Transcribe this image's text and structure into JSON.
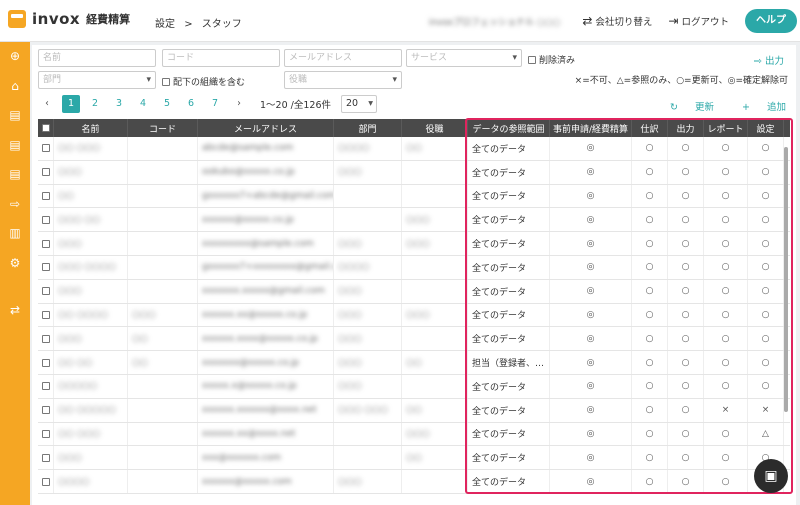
{
  "app": {
    "logo": "invox",
    "logo_sub": "経費精算"
  },
  "breadcrumb": {
    "level1": "設定",
    "separator": ">",
    "level2": "スタッフ"
  },
  "header": {
    "company": "invoxプロフェッショナル",
    "user": "○○○",
    "switch_company": "会社切り替え",
    "logout": "ログアウト",
    "help": "ヘルプ"
  },
  "sidebar_icons": [
    "plus-circle-icon",
    "home-icon",
    "document-icon",
    "document-icon",
    "document-icon",
    "export-icon",
    "chart-icon",
    "gear-icon",
    "transfer-icon"
  ],
  "filters": {
    "name_placeholder": "名前",
    "code_placeholder": "コード",
    "email_placeholder": "メールアドレス",
    "service_placeholder": "サービス",
    "deleted_label": "削除済み",
    "dept_placeholder": "部門",
    "include_sub_label": "配下の組織を含む",
    "position_placeholder": "役職",
    "output_label": "出力",
    "legend": "×=不可、△=参照のみ、○=更新可、◎=確定解除可"
  },
  "pager": {
    "pages": [
      "1",
      "2",
      "3",
      "4",
      "5",
      "6",
      "7"
    ],
    "prev": "‹",
    "next": "›",
    "info": "1〜20 /全126件",
    "per_page": "20",
    "refresh": "更新",
    "add": "追加"
  },
  "table": {
    "headers": [
      "名前",
      "コード",
      "メールアドレス",
      "部門",
      "役職",
      "データの参照範囲",
      "事前申請/経費精算",
      "仕訳",
      "出力",
      "レポート",
      "設定"
    ],
    "rows": [
      {
        "name": "○○ ○○○",
        "code": "",
        "email": "abcde@sample.com",
        "dept": "○○○○",
        "pos": "○○",
        "scope": "全てのデータ",
        "pre": "◎",
        "j": "○",
        "o": "○",
        "r": "○",
        "s": "○"
      },
      {
        "name": "○○○",
        "code": "",
        "email": "ookubo@xxxxx.co.jp",
        "dept": "○○○",
        "pos": "",
        "scope": "全てのデータ",
        "pre": "◎",
        "j": "○",
        "o": "○",
        "r": "○",
        "s": "○"
      },
      {
        "name": "○○",
        "code": "",
        "email": "gxxxxxx7+abcde@gmail.com",
        "dept": "",
        "pos": "",
        "scope": "全てのデータ",
        "pre": "◎",
        "j": "○",
        "o": "○",
        "r": "○",
        "s": "○"
      },
      {
        "name": "○○○ ○○",
        "code": "",
        "email": "xxxxxx@xxxxx.co.jp",
        "dept": "",
        "pos": "○○○",
        "scope": "全てのデータ",
        "pre": "◎",
        "j": "○",
        "o": "○",
        "r": "○",
        "s": "○"
      },
      {
        "name": "○○○",
        "code": "",
        "email": "xxxxxxxxx@sample.com",
        "dept": "○○○",
        "pos": "○○○",
        "scope": "全てのデータ",
        "pre": "◎",
        "j": "○",
        "o": "○",
        "r": "○",
        "s": "○"
      },
      {
        "name": "○○○ ○○○○",
        "code": "",
        "email": "gxxxxxx7+xxxxxxxx@gmail.com",
        "dept": "○○○○",
        "pos": "",
        "scope": "全てのデータ",
        "pre": "◎",
        "j": "○",
        "o": "○",
        "r": "○",
        "s": "○"
      },
      {
        "name": "○○○",
        "code": "",
        "email": "xxxxxxx.xxxxx@gmail.com",
        "dept": "○○○",
        "pos": "",
        "scope": "全てのデータ",
        "pre": "◎",
        "j": "○",
        "o": "○",
        "r": "○",
        "s": "○"
      },
      {
        "name": "○○ ○○○○",
        "code": "○○○",
        "email": "xxxxxx.xx@xxxxx.co.jp",
        "dept": "○○○",
        "pos": "○○○",
        "scope": "全てのデータ",
        "pre": "◎",
        "j": "○",
        "o": "○",
        "r": "○",
        "s": "○"
      },
      {
        "name": "○○○",
        "code": "○○",
        "email": "xxxxxx.xxxx@xxxxx.co.jp",
        "dept": "○○○",
        "pos": "",
        "scope": "全てのデータ",
        "pre": "◎",
        "j": "○",
        "o": "○",
        "r": "○",
        "s": "○"
      },
      {
        "name": "○○ ○○",
        "code": "○○",
        "email": "xxxxxxx@xxxxx.co.jp",
        "dept": "○○○",
        "pos": "○○",
        "scope": "担当（登録者、…",
        "pre": "◎",
        "j": "○",
        "o": "○",
        "r": "○",
        "s": "○"
      },
      {
        "name": "○○○○○",
        "code": "",
        "email": "xxxxx.x@xxxxx.co.jp",
        "dept": "○○○",
        "pos": "",
        "scope": "全てのデータ",
        "pre": "◎",
        "j": "○",
        "o": "○",
        "r": "○",
        "s": "○"
      },
      {
        "name": "○○ ○○○○○",
        "code": "",
        "email": "xxxxxx.xxxxxx@xxxx.net",
        "dept": "○○○ ○○○",
        "pos": "○○",
        "scope": "全てのデータ",
        "pre": "◎",
        "j": "○",
        "o": "○",
        "r": "×",
        "s": "×"
      },
      {
        "name": "○○ ○○○",
        "code": "",
        "email": "xxxxxx.xx@xxxx.net",
        "dept": "",
        "pos": "○○○",
        "scope": "全てのデータ",
        "pre": "◎",
        "j": "○",
        "o": "○",
        "r": "○",
        "s": "△"
      },
      {
        "name": "○○○",
        "code": "",
        "email": "xxx@xxxxxx.com",
        "dept": "",
        "pos": "○○",
        "scope": "全てのデータ",
        "pre": "◎",
        "j": "○",
        "o": "○",
        "r": "○",
        "s": "○"
      },
      {
        "name": "○○○○",
        "code": "",
        "email": "xxxxxx@xxxxx.com",
        "dept": "○○○",
        "pos": "",
        "scope": "全てのデータ",
        "pre": "◎",
        "j": "○",
        "o": "○",
        "r": "○",
        "s": "○"
      }
    ]
  }
}
